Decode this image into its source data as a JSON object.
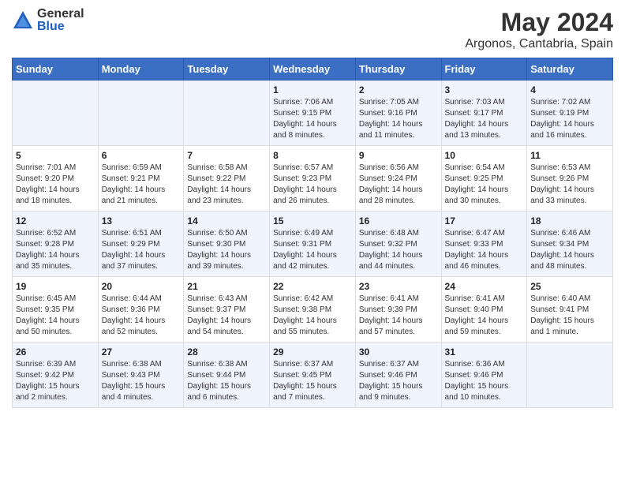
{
  "logo": {
    "general": "General",
    "blue": "Blue"
  },
  "title": "May 2024",
  "subtitle": "Argonos, Cantabria, Spain",
  "headers": [
    "Sunday",
    "Monday",
    "Tuesday",
    "Wednesday",
    "Thursday",
    "Friday",
    "Saturday"
  ],
  "rows": [
    [
      {
        "day": "",
        "content": ""
      },
      {
        "day": "",
        "content": ""
      },
      {
        "day": "",
        "content": ""
      },
      {
        "day": "1",
        "content": "Sunrise: 7:06 AM\nSunset: 9:15 PM\nDaylight: 14 hours\nand 8 minutes."
      },
      {
        "day": "2",
        "content": "Sunrise: 7:05 AM\nSunset: 9:16 PM\nDaylight: 14 hours\nand 11 minutes."
      },
      {
        "day": "3",
        "content": "Sunrise: 7:03 AM\nSunset: 9:17 PM\nDaylight: 14 hours\nand 13 minutes."
      },
      {
        "day": "4",
        "content": "Sunrise: 7:02 AM\nSunset: 9:19 PM\nDaylight: 14 hours\nand 16 minutes."
      }
    ],
    [
      {
        "day": "5",
        "content": "Sunrise: 7:01 AM\nSunset: 9:20 PM\nDaylight: 14 hours\nand 18 minutes."
      },
      {
        "day": "6",
        "content": "Sunrise: 6:59 AM\nSunset: 9:21 PM\nDaylight: 14 hours\nand 21 minutes."
      },
      {
        "day": "7",
        "content": "Sunrise: 6:58 AM\nSunset: 9:22 PM\nDaylight: 14 hours\nand 23 minutes."
      },
      {
        "day": "8",
        "content": "Sunrise: 6:57 AM\nSunset: 9:23 PM\nDaylight: 14 hours\nand 26 minutes."
      },
      {
        "day": "9",
        "content": "Sunrise: 6:56 AM\nSunset: 9:24 PM\nDaylight: 14 hours\nand 28 minutes."
      },
      {
        "day": "10",
        "content": "Sunrise: 6:54 AM\nSunset: 9:25 PM\nDaylight: 14 hours\nand 30 minutes."
      },
      {
        "day": "11",
        "content": "Sunrise: 6:53 AM\nSunset: 9:26 PM\nDaylight: 14 hours\nand 33 minutes."
      }
    ],
    [
      {
        "day": "12",
        "content": "Sunrise: 6:52 AM\nSunset: 9:28 PM\nDaylight: 14 hours\nand 35 minutes."
      },
      {
        "day": "13",
        "content": "Sunrise: 6:51 AM\nSunset: 9:29 PM\nDaylight: 14 hours\nand 37 minutes."
      },
      {
        "day": "14",
        "content": "Sunrise: 6:50 AM\nSunset: 9:30 PM\nDaylight: 14 hours\nand 39 minutes."
      },
      {
        "day": "15",
        "content": "Sunrise: 6:49 AM\nSunset: 9:31 PM\nDaylight: 14 hours\nand 42 minutes."
      },
      {
        "day": "16",
        "content": "Sunrise: 6:48 AM\nSunset: 9:32 PM\nDaylight: 14 hours\nand 44 minutes."
      },
      {
        "day": "17",
        "content": "Sunrise: 6:47 AM\nSunset: 9:33 PM\nDaylight: 14 hours\nand 46 minutes."
      },
      {
        "day": "18",
        "content": "Sunrise: 6:46 AM\nSunset: 9:34 PM\nDaylight: 14 hours\nand 48 minutes."
      }
    ],
    [
      {
        "day": "19",
        "content": "Sunrise: 6:45 AM\nSunset: 9:35 PM\nDaylight: 14 hours\nand 50 minutes."
      },
      {
        "day": "20",
        "content": "Sunrise: 6:44 AM\nSunset: 9:36 PM\nDaylight: 14 hours\nand 52 minutes."
      },
      {
        "day": "21",
        "content": "Sunrise: 6:43 AM\nSunset: 9:37 PM\nDaylight: 14 hours\nand 54 minutes."
      },
      {
        "day": "22",
        "content": "Sunrise: 6:42 AM\nSunset: 9:38 PM\nDaylight: 14 hours\nand 55 minutes."
      },
      {
        "day": "23",
        "content": "Sunrise: 6:41 AM\nSunset: 9:39 PM\nDaylight: 14 hours\nand 57 minutes."
      },
      {
        "day": "24",
        "content": "Sunrise: 6:41 AM\nSunset: 9:40 PM\nDaylight: 14 hours\nand 59 minutes."
      },
      {
        "day": "25",
        "content": "Sunrise: 6:40 AM\nSunset: 9:41 PM\nDaylight: 15 hours\nand 1 minute."
      }
    ],
    [
      {
        "day": "26",
        "content": "Sunrise: 6:39 AM\nSunset: 9:42 PM\nDaylight: 15 hours\nand 2 minutes."
      },
      {
        "day": "27",
        "content": "Sunrise: 6:38 AM\nSunset: 9:43 PM\nDaylight: 15 hours\nand 4 minutes."
      },
      {
        "day": "28",
        "content": "Sunrise: 6:38 AM\nSunset: 9:44 PM\nDaylight: 15 hours\nand 6 minutes."
      },
      {
        "day": "29",
        "content": "Sunrise: 6:37 AM\nSunset: 9:45 PM\nDaylight: 15 hours\nand 7 minutes."
      },
      {
        "day": "30",
        "content": "Sunrise: 6:37 AM\nSunset: 9:46 PM\nDaylight: 15 hours\nand 9 minutes."
      },
      {
        "day": "31",
        "content": "Sunrise: 6:36 AM\nSunset: 9:46 PM\nDaylight: 15 hours\nand 10 minutes."
      },
      {
        "day": "",
        "content": ""
      }
    ]
  ]
}
